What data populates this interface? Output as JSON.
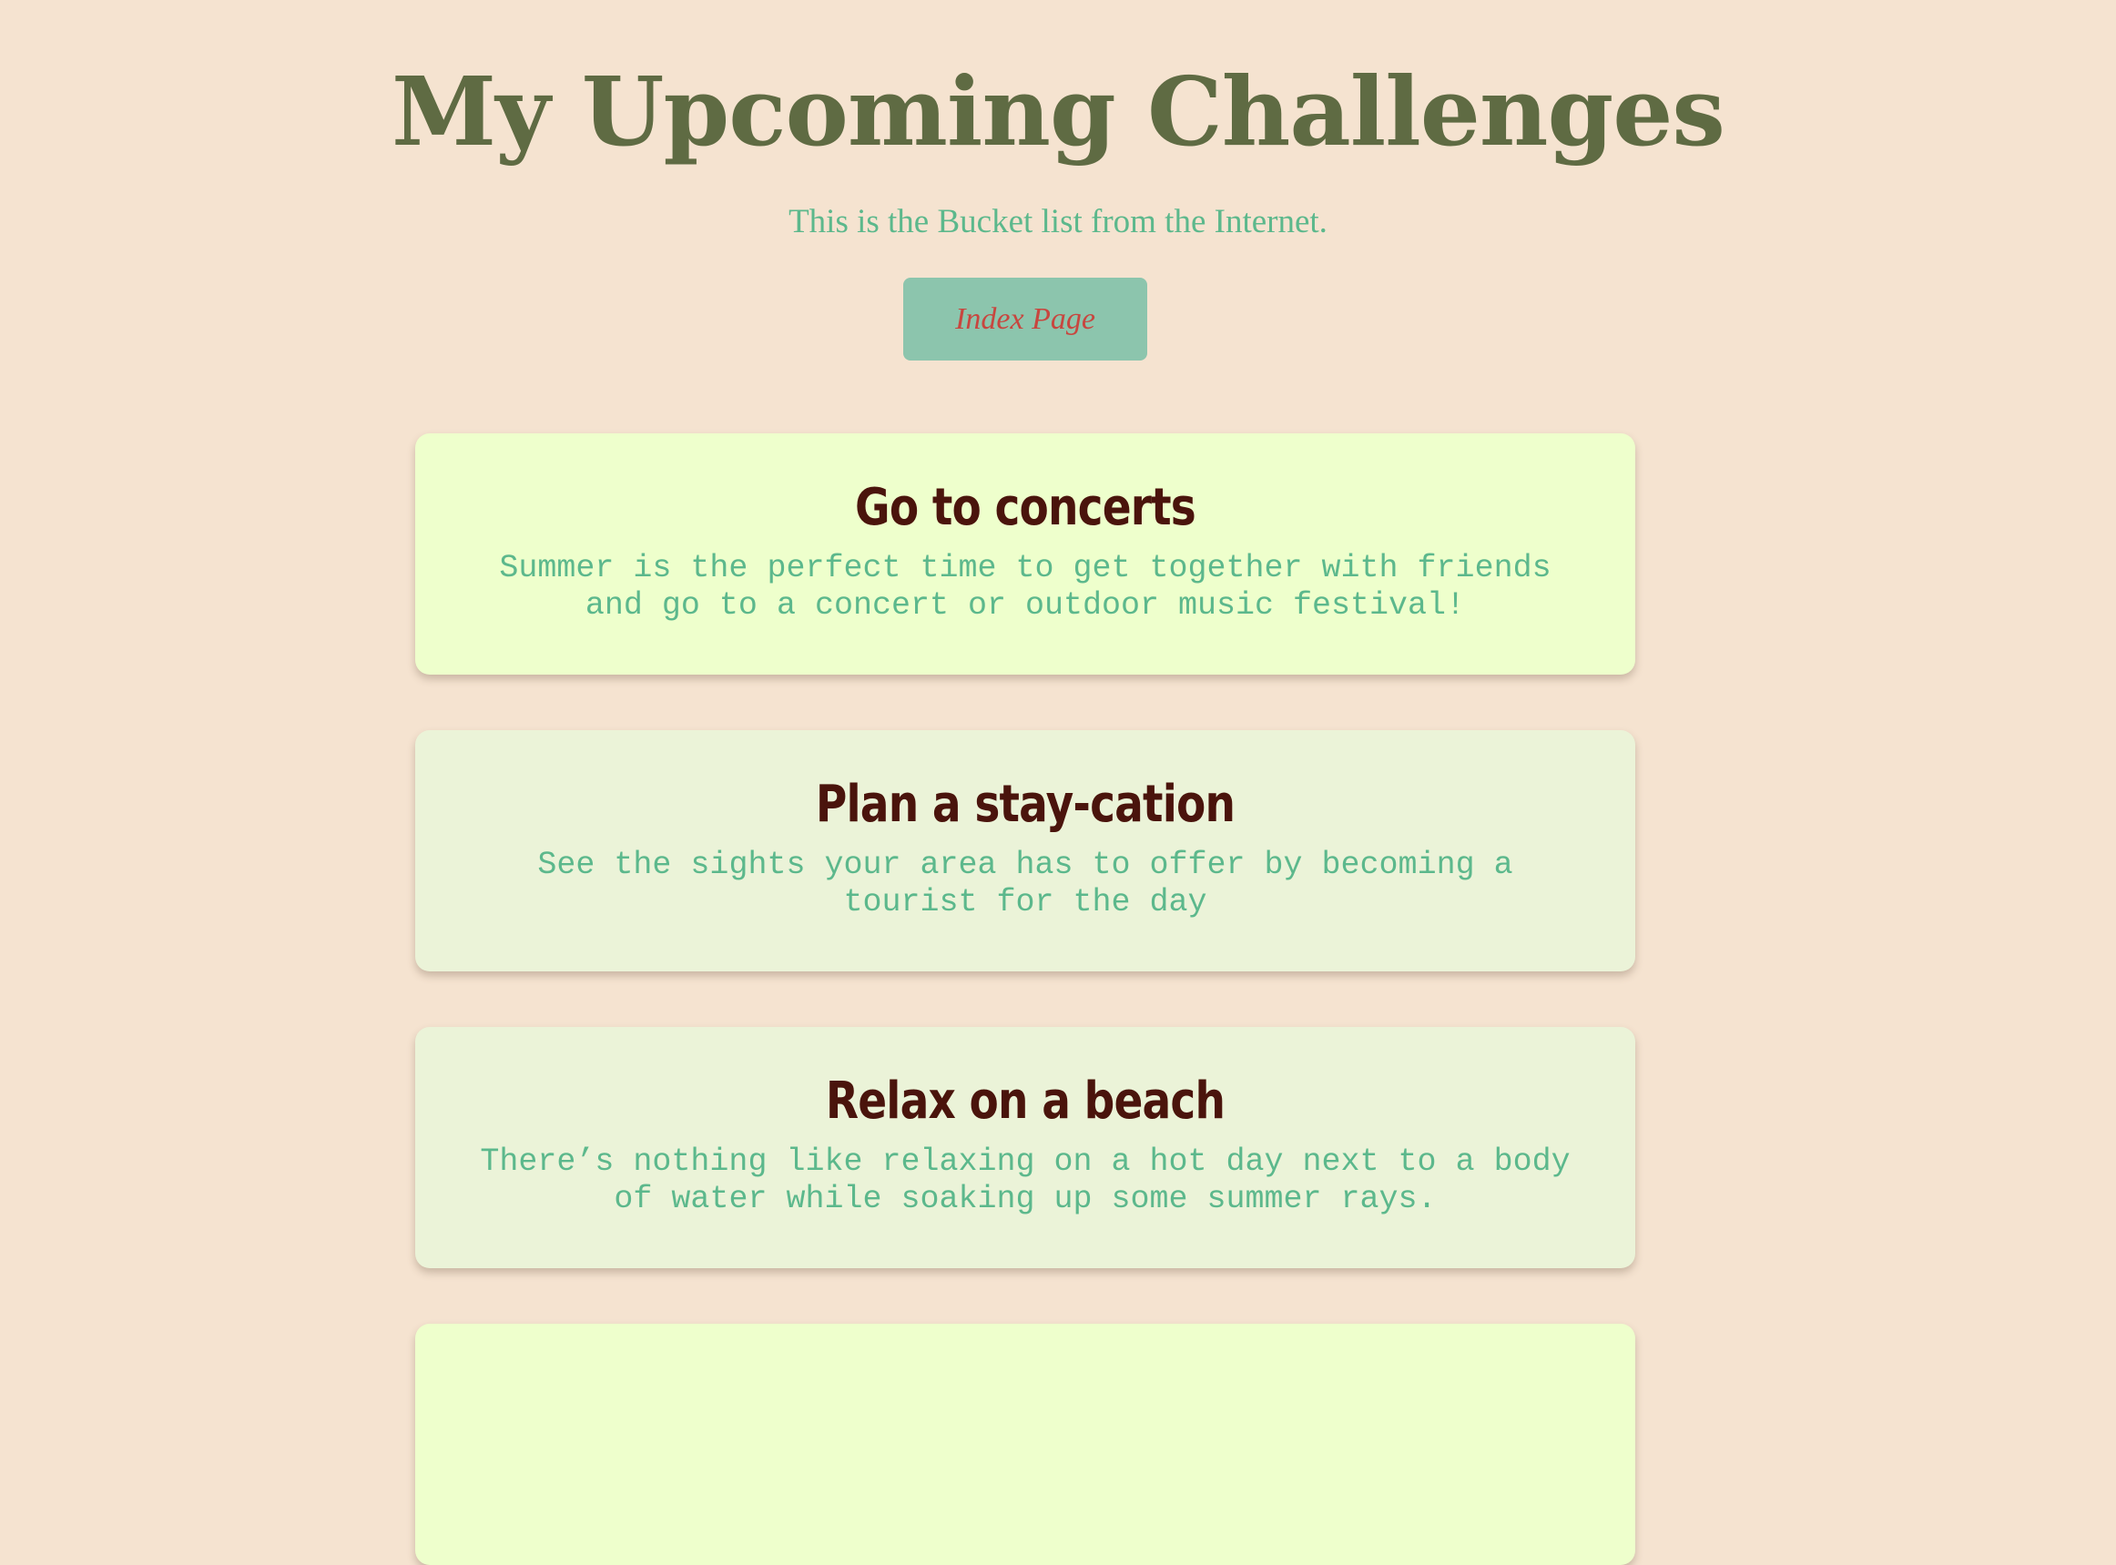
{
  "header": {
    "title": "My Upcoming Challenges",
    "subtitle": "This is the Bucket list from the Internet.",
    "index_button_label": "Index Page"
  },
  "colors": {
    "background": "#f5e3d0",
    "title": "#5f6b43",
    "subtitle": "#5cb88c",
    "button_bg": "#8cc5ad",
    "button_text": "#c8463f",
    "card_highlight_bg": "#eeffcc",
    "card_bg": "#ebf3d8",
    "card_title": "#4a140c",
    "card_text": "#5cb88c"
  },
  "cards": [
    {
      "title": "Go to concerts",
      "description": "Summer is the perfect time to get together with friends and go to a concert or outdoor music festival!"
    },
    {
      "title": "Plan a stay-cation",
      "description": "See the sights your area has to offer by becoming a tourist for the day"
    },
    {
      "title": "Relax on a beach",
      "description": "There’s nothing like relaxing on a hot day next to a body of water while soaking up some summer rays."
    }
  ]
}
